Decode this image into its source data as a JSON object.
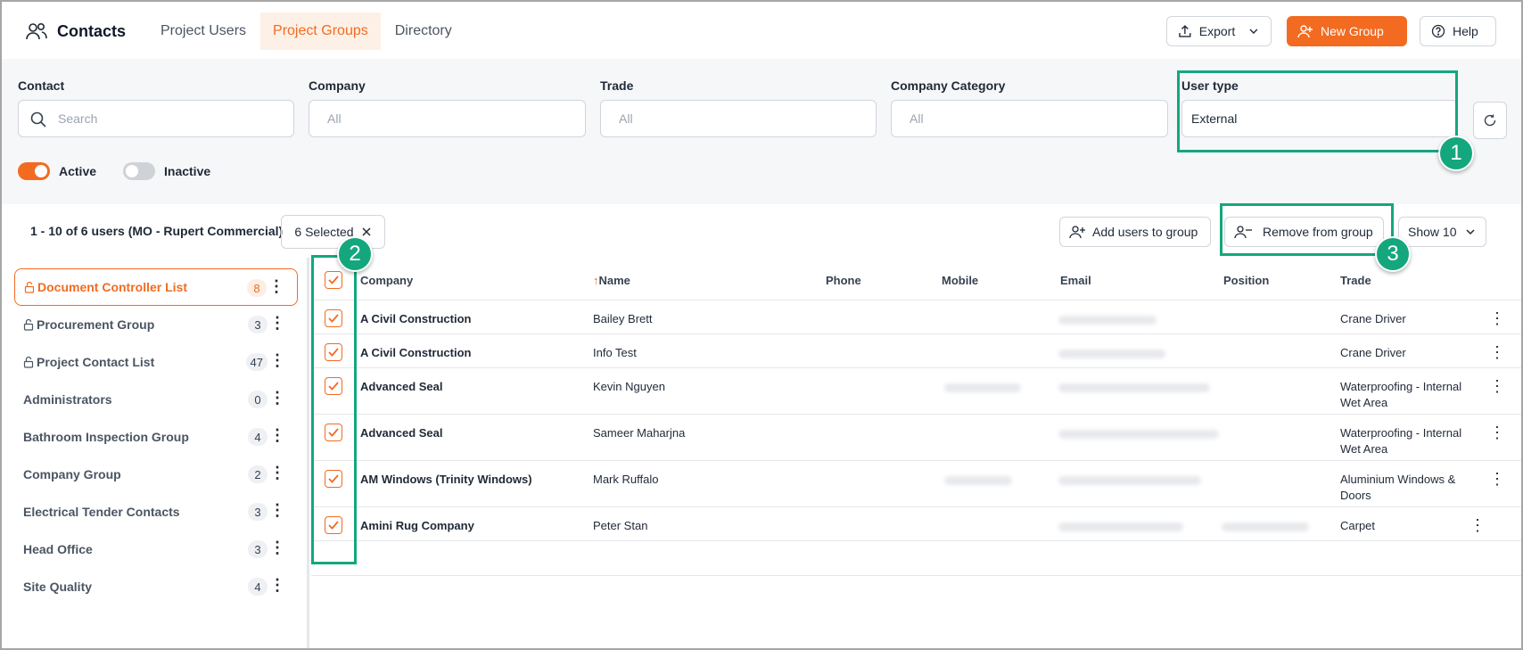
{
  "header": {
    "title": "Contacts",
    "tabs": [
      {
        "label": "Project Users",
        "active": false
      },
      {
        "label": "Project Groups",
        "active": true
      },
      {
        "label": "Directory",
        "active": false
      }
    ],
    "export_label": "Export",
    "new_group_label": "New Group",
    "help_label": "Help"
  },
  "filters": {
    "contact_label": "Contact",
    "contact_placeholder": "Search",
    "company_label": "Company",
    "company_value": "All",
    "trade_label": "Trade",
    "trade_value": "All",
    "category_label": "Company Category",
    "category_value": "All",
    "usertype_label": "User type",
    "usertype_value": "External",
    "active_label": "Active",
    "inactive_label": "Inactive"
  },
  "toolbar": {
    "count_text": "1 - 10 of 6 users (MO - Rupert Commercial)",
    "selected_text": "6 Selected",
    "add_users_label": "Add users to group",
    "remove_label": "Remove from group",
    "show_label": "Show 10"
  },
  "groups": [
    {
      "label": "Document Controller List",
      "count": "8",
      "locked": true,
      "active": true
    },
    {
      "label": "Procurement Group",
      "count": "3",
      "locked": true,
      "active": false
    },
    {
      "label": "Project Contact List",
      "count": "47",
      "locked": true,
      "active": false
    },
    {
      "label": "Administrators",
      "count": "0",
      "locked": false,
      "active": false
    },
    {
      "label": "Bathroom Inspection Group",
      "count": "4",
      "locked": false,
      "active": false
    },
    {
      "label": "Company Group",
      "count": "2",
      "locked": false,
      "active": false
    },
    {
      "label": "Electrical Tender Contacts",
      "count": "3",
      "locked": false,
      "active": false
    },
    {
      "label": "Head Office",
      "count": "3",
      "locked": false,
      "active": false
    },
    {
      "label": "Site Quality",
      "count": "4",
      "locked": false,
      "active": false
    }
  ],
  "table": {
    "headers": {
      "company": "Company",
      "name_sort": "↑",
      "name": "Name",
      "phone": "Phone",
      "mobile": "Mobile",
      "email": "Email",
      "position": "Position",
      "trade": "Trade"
    },
    "rows": [
      {
        "company": "A Civil Construction",
        "name": "Bailey Brett",
        "trade": "Crane Driver",
        "checked": true
      },
      {
        "company": "A Civil Construction",
        "name": "Info Test",
        "trade": "Crane Driver",
        "checked": true
      },
      {
        "company": "Advanced Seal",
        "name": "Kevin Nguyen",
        "trade": "Waterproofing - Internal Wet Area",
        "checked": true
      },
      {
        "company": "Advanced Seal",
        "name": "Sameer Maharjna",
        "trade": "Waterproofing - Internal Wet Area",
        "checked": true
      },
      {
        "company": "AM Windows (Trinity Windows)",
        "name": "Mark Ruffalo",
        "trade": "Aluminium Windows & Doors",
        "checked": true
      },
      {
        "company": "Amini Rug Company",
        "name": "Peter Stan",
        "trade": "Carpet",
        "checked": true
      }
    ]
  },
  "annotations": [
    "1",
    "2",
    "3"
  ],
  "colors": {
    "accent": "#f26b21",
    "annotation": "#14a77d"
  }
}
